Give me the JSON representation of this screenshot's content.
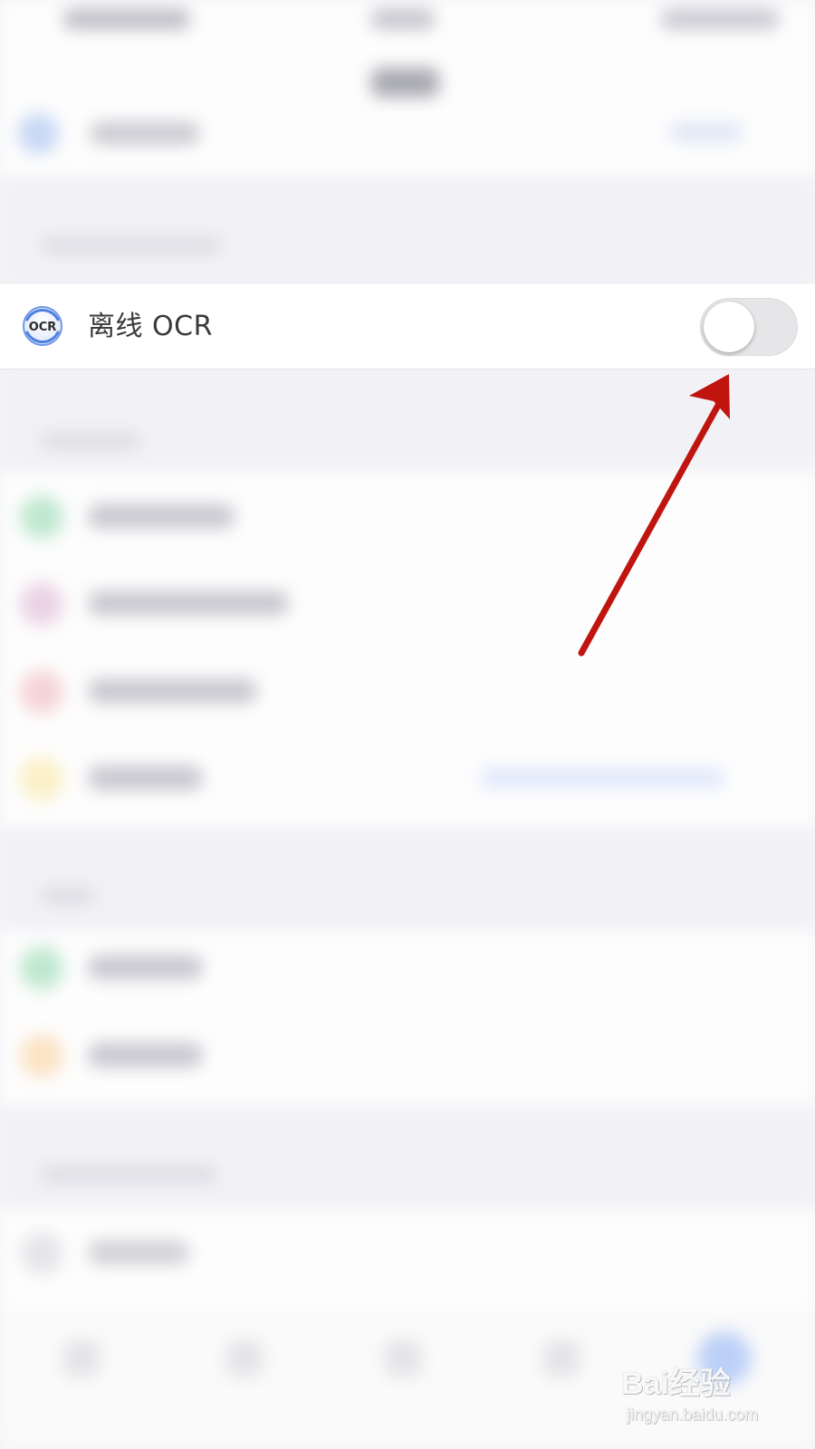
{
  "offline_ocr_row": {
    "icon": "ocr-icon",
    "icon_text": "OCR",
    "label": "离线 OCR",
    "toggle_state": "off"
  },
  "annotation": {
    "type": "arrow",
    "color": "#c0140f",
    "target": "offline-ocr-toggle"
  },
  "watermark": {
    "brand": "Bai经验",
    "url": "jingyan.baidu.com"
  },
  "colors": {
    "icon_blue": "#4d7fe0",
    "toggle_off": "#e6e6e8",
    "arrow_red": "#c0140f"
  }
}
